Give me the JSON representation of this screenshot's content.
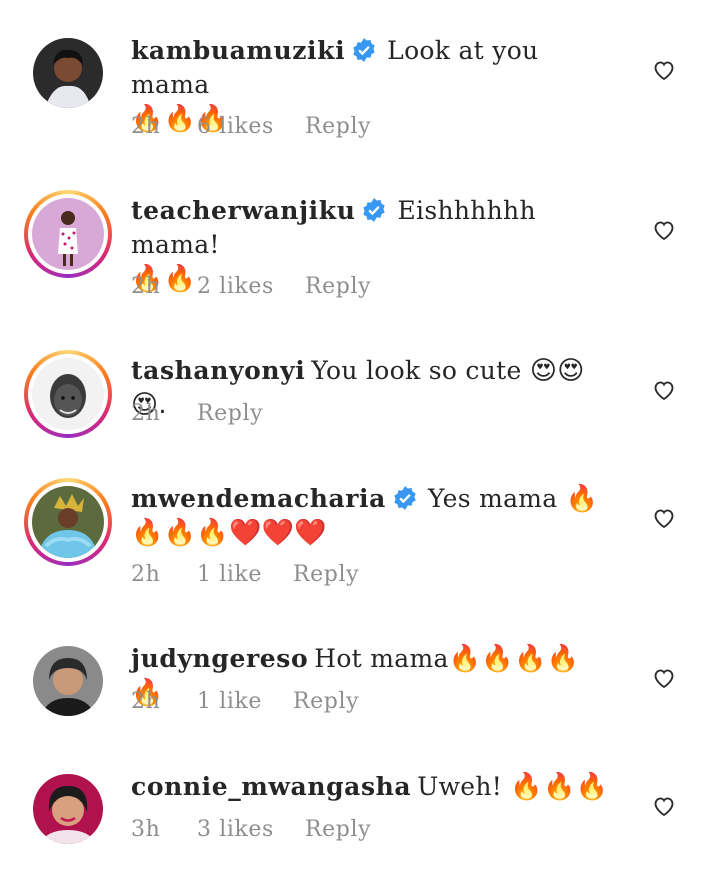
{
  "comments": [
    {
      "username": "kambuamuziki",
      "verified": true,
      "text": "Look at you mama",
      "emoji": "🔥🔥🔥",
      "time": "2h",
      "likes": "6 likes",
      "reply_label": "Reply",
      "story_ring": false
    },
    {
      "username": "teacherwanjiku",
      "verified": true,
      "text": "Eishhhhhh mama!",
      "emoji": "🔥🔥",
      "time": "2h",
      "likes": "2 likes",
      "reply_label": "Reply",
      "story_ring": true
    },
    {
      "username": "tashanyonyi",
      "verified": false,
      "text": "You look so cute",
      "emoji": "😍😍😍.",
      "time": "2h",
      "likes": "",
      "reply_label": "Reply",
      "story_ring": true
    },
    {
      "username": "mwendemacharia",
      "verified": true,
      "text": "Yes mama",
      "emoji": "🔥🔥🔥🔥❤️❤️❤️",
      "time": "2h",
      "likes": "1 like",
      "reply_label": "Reply",
      "story_ring": true
    },
    {
      "username": "judyngereso",
      "verified": false,
      "text": "Hot mama",
      "emoji": "🔥🔥🔥🔥🔥",
      "time": "2h",
      "likes": "1 like",
      "reply_label": "Reply",
      "story_ring": false
    },
    {
      "username": "connie_mwangasha",
      "verified": false,
      "text": "Uweh!",
      "emoji": "🔥🔥🔥",
      "time": "3h",
      "likes": "3 likes",
      "reply_label": "Reply",
      "story_ring": false
    }
  ],
  "icons": {
    "verified": "verified-badge-icon",
    "like": "heart-outline-icon"
  },
  "colors": {
    "verified_blue": "#3897f0",
    "meta_gray": "#8e8e8e",
    "text": "#262626"
  }
}
